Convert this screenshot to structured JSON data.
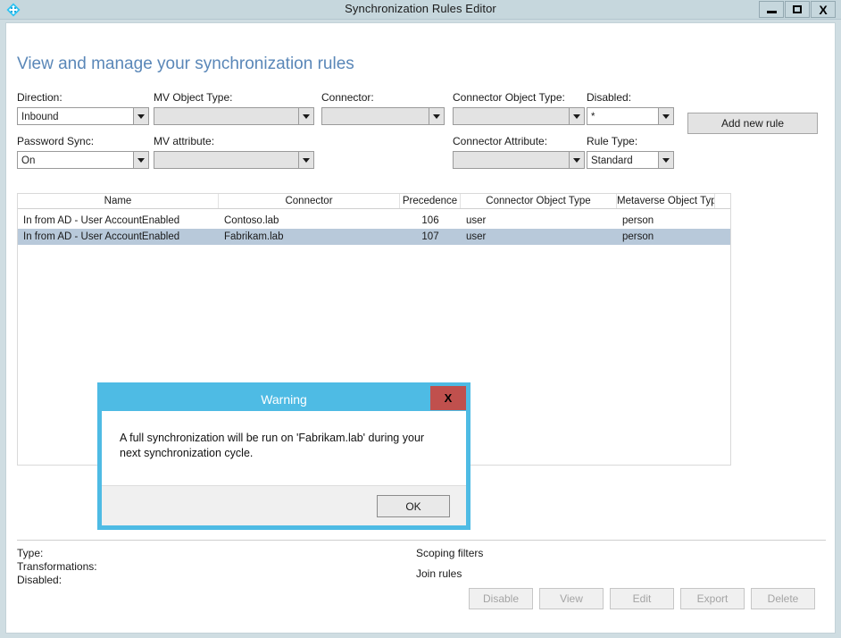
{
  "window": {
    "title": "Synchronization Rules Editor",
    "icon": "sync-diamond-icon",
    "controls": {
      "minimize": "minimize-icon",
      "maximize": "maximize-icon",
      "close": "X"
    }
  },
  "page": {
    "heading": "View and manage your synchronization rules"
  },
  "filters": [
    {
      "label": "Direction:",
      "value": "Inbound",
      "name": "direction"
    },
    {
      "label": "MV Object Type:",
      "value": "",
      "name": "mv-object-type"
    },
    {
      "label": "Connector:",
      "value": "",
      "name": "connector"
    },
    {
      "label": "Connector Object Type:",
      "value": "",
      "name": "connector-object-type"
    },
    {
      "label": "Disabled:",
      "value": "*",
      "name": "disabled"
    },
    {
      "label": "Password Sync:",
      "value": "On",
      "name": "password-sync"
    },
    {
      "label": "MV attribute:",
      "value": "",
      "name": "mv-attribute"
    },
    {
      "label": "Connector Attribute:",
      "value": "",
      "name": "connector-attribute"
    },
    {
      "label": "Rule Type:",
      "value": "Standard",
      "name": "rule-type"
    }
  ],
  "add_rule_button": "Add new rule",
  "table": {
    "columns": [
      "Name",
      "Connector",
      "Precedence",
      "Connector Object Type",
      "Metaverse Object Type"
    ],
    "rows": [
      {
        "name": "In from AD - User AccountEnabled",
        "connector": "Contoso.lab",
        "precedence": "106",
        "connector_object_type": "user",
        "metaverse_object_type": "person",
        "selected": false
      },
      {
        "name": "In from AD - User AccountEnabled",
        "connector": "Fabrikam.lab",
        "precedence": "107",
        "connector_object_type": "user",
        "metaverse_object_type": "person",
        "selected": true
      }
    ]
  },
  "details": {
    "type_label": "Type:",
    "transformations_label": "Transformations:",
    "disabled_label": "Disabled:",
    "scoping_filters_label": "Scoping filters",
    "join_rules_label": "Join rules"
  },
  "action_buttons": [
    {
      "label": "Disable",
      "name": "disable-button",
      "disabled": true
    },
    {
      "label": "View",
      "name": "view-button",
      "disabled": true
    },
    {
      "label": "Edit",
      "name": "edit-button",
      "disabled": true
    },
    {
      "label": "Export",
      "name": "export-button",
      "disabled": true
    },
    {
      "label": "Delete",
      "name": "delete-button",
      "disabled": true
    }
  ],
  "dialog": {
    "title": "Warning",
    "close_label": "X",
    "message": "A full synchronization will be run on 'Fabrikam.lab' during your next synchronization cycle.",
    "ok_label": "OK"
  },
  "colors": {
    "title_bar": "#c6d7dd",
    "heading": "#5a87b8",
    "dialog_border": "#4ebbe4",
    "dialog_close": "#c0504d",
    "row_selected": "#b8c9da",
    "icon_cyan": "#2bc4f3"
  }
}
